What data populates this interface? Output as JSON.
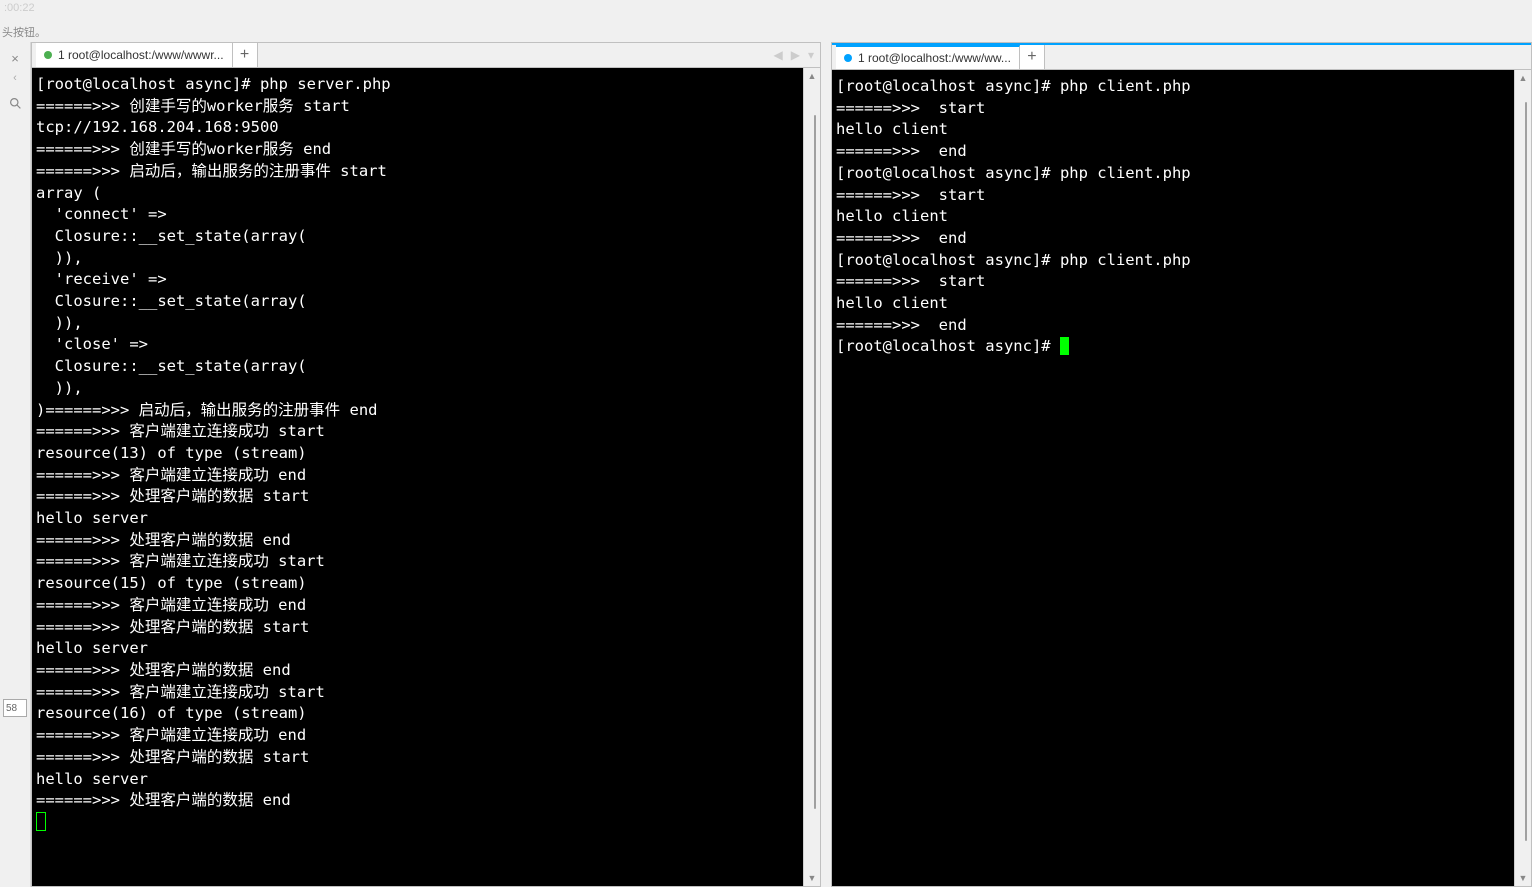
{
  "header": {
    "time_fragment": ":00:22",
    "hint_text": "头按钮。"
  },
  "sidebar": {
    "close_label": "×",
    "arrow_label": "‹",
    "number_value": "58"
  },
  "left_pane": {
    "tab": {
      "dot_color": "green",
      "label": "1 root@localhost:/www/wwwr..."
    },
    "nav": {
      "left": "◀",
      "right": "▶",
      "down": "▾"
    },
    "add_label": "+",
    "terminal_lines": [
      "[root@localhost async]# php server.php",
      "======>>> 创建手写的worker服务 start",
      "tcp://192.168.204.168:9500",
      "======>>> 创建手写的worker服务 end",
      "======>>> 启动后，输出服务的注册事件 start",
      "array (",
      "  'connect' =>",
      "  Closure::__set_state(array(",
      "  )),",
      "  'receive' =>",
      "  Closure::__set_state(array(",
      "  )),",
      "  'close' =>",
      "  Closure::__set_state(array(",
      "  )),",
      ")======>>> 启动后，输出服务的注册事件 end",
      "======>>> 客户端建立连接成功 start",
      "resource(13) of type (stream)",
      "======>>> 客户端建立连接成功 end",
      "======>>> 处理客户端的数据 start",
      "hello server",
      "======>>> 处理客户端的数据 end",
      "======>>> 客户端建立连接成功 start",
      "resource(15) of type (stream)",
      "======>>> 客户端建立连接成功 end",
      "======>>> 处理客户端的数据 start",
      "hello server",
      "======>>> 处理客户端的数据 end",
      "======>>> 客户端建立连接成功 start",
      "resource(16) of type (stream)",
      "======>>> 客户端建立连接成功 end",
      "======>>> 处理客户端的数据 start",
      "hello server",
      "======>>> 处理客户端的数据 end"
    ],
    "scrollbar": {
      "thumb_top_pct": 4,
      "thumb_height_pct": 88
    }
  },
  "right_pane": {
    "tab": {
      "dot_color": "blue",
      "label": "1 root@localhost:/www/ww..."
    },
    "add_label": "+",
    "terminal_lines": [
      "[root@localhost async]# php client.php",
      "======>>>  start",
      "hello client",
      "======>>>  end",
      "[root@localhost async]# php client.php",
      "======>>>  start",
      "hello client",
      "======>>>  end",
      "[root@localhost async]# php client.php",
      "======>>>  start",
      "hello client",
      "======>>>  end",
      "[root@localhost async]# "
    ],
    "scrollbar": {
      "thumb_top_pct": 2,
      "thumb_height_pct": 94
    }
  }
}
